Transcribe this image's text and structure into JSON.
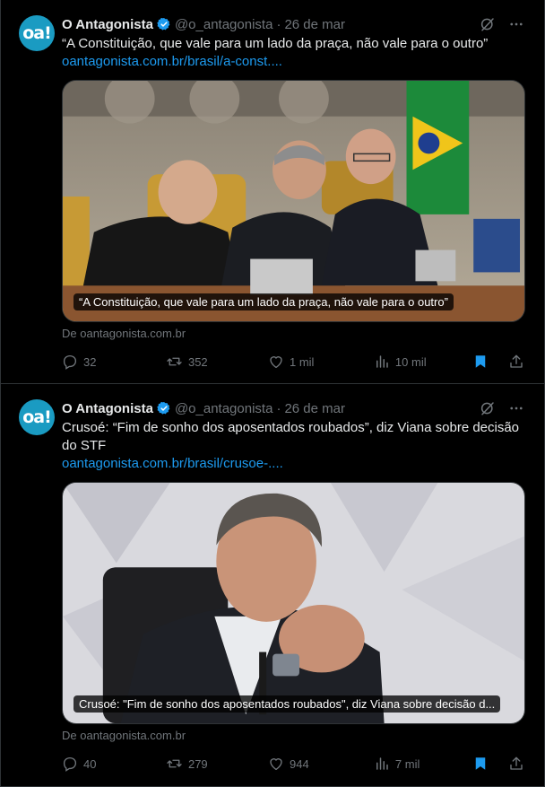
{
  "tweets": [
    {
      "author": {
        "name": "O Antagonista",
        "handle": "@o_antagonista",
        "avatar_text": "oa!"
      },
      "date": "26 de mar",
      "text": "“A Constituição, que vale para um lado da praça, não vale para o outro”",
      "link": "oantagonista.com.br/brasil/a-const....",
      "card": {
        "overlay": "“A Constituição, que vale para um lado da praça, não vale para o outro”",
        "source": "De oantagonista.com.br"
      },
      "stats": {
        "replies": "32",
        "reposts": "352",
        "likes": "1 mil",
        "views": "10 mil"
      }
    },
    {
      "author": {
        "name": "O Antagonista",
        "handle": "@o_antagonista",
        "avatar_text": "oa!"
      },
      "date": "26 de mar",
      "text": "Crusoé: “Fim de sonho dos aposentados roubados”, diz Viana sobre decisão do STF",
      "link": "oantagonista.com.br/brasil/crusoe-....",
      "card": {
        "overlay": "Crusoé: \"Fim de sonho dos aposentados roubados\", diz Viana sobre decisão d...",
        "source": "De oantagonista.com.br"
      },
      "stats": {
        "replies": "40",
        "reposts": "279",
        "likes": "944",
        "views": "7 mil"
      }
    }
  ],
  "colors": {
    "background": "#000000",
    "text": "#e7e9ea",
    "muted": "#71767b",
    "link": "#1d9bf0",
    "verified": "#1d9bf0",
    "bookmark_active": "#1d9bf0",
    "avatar": "#1a9bc2",
    "border": "#2f3336"
  },
  "icons": [
    "verified-badge-icon",
    "grok-icon",
    "more-icon",
    "reply-icon",
    "repost-icon",
    "like-icon",
    "views-icon",
    "bookmark-icon",
    "share-icon"
  ]
}
